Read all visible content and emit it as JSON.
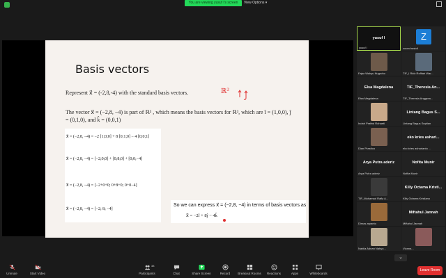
{
  "banner": {
    "viewing": "You are viewing yusuf l's screen",
    "view_options": "View Options ▾"
  },
  "slide": {
    "title": "Basis vectors",
    "represent": "Represent  x⃗ = (-2,8,-4) with the standard basis vectors.",
    "handwriting": "ℝ²",
    "para1": "The vector x⃗ = (−2,8, −4) is part of ℝ³ , which means the basis vectors for ℝ³, which are î = (1,0,0), ĵ = (0,1,0), and k̂ = (0,0,1)",
    "eq1": "x⃗ = (−2,8, −4) = −2 [1;0;0] + 8 [0;1;0] − 4 [0;0;1]",
    "eq2": "x⃗ = (−2,8, −4) = [−2;0;0] + [0;8;0] + [0;0;−4]",
    "eq3": "x⃗ = (−2,8, −4) = [−2+0+0; 0+8+0; 0+0−4]",
    "eq4": "x⃗ = (−2,8, −4) = [−2; 8; −4]",
    "so_text": "So we can express x⃗ = (−2,8, −4) in terms of basis vectors as",
    "so_eq": "x⃗ = −2î + 8ĵ − 4k̂"
  },
  "participants": [
    {
      "name": "yusuf l",
      "sub": "yusuf l"
    },
    {
      "name": "Z",
      "sub": "zoom basic4"
    },
    {
      "name": "",
      "sub": "Fajar Wahyu Nugroho"
    },
    {
      "name": "",
      "sub": "TIF_I Ridz Rofifah War..."
    },
    {
      "name": "Elsa Magdalena",
      "sub": "Elsa Magdalena"
    },
    {
      "name": "TIF_Theresia An...",
      "sub": "TIF_Theresia Anggrea..."
    },
    {
      "name": "",
      "sub": "Indah Pratiwi Rohaeti"
    },
    {
      "name": "Lintang Bagus S...",
      "sub": "Lintang Bagus Septian"
    },
    {
      "name": "",
      "sub": "Dian Prastica"
    },
    {
      "name": "eko kries ashari...",
      "sub": "eko kries asharianto ..."
    },
    {
      "name": "Arya Putra aderiz",
      "sub": "Arya Putra aderiz"
    },
    {
      "name": "Nofita Munir",
      "sub": "Nofita Munir"
    },
    {
      "name": "",
      "sub": "TIF_Muhamad Rafly A..."
    },
    {
      "name": "Killy Octama Kristi...",
      "sub": "Killy Octama Kristiano"
    },
    {
      "name": "",
      "sub": "Dimas aryanto"
    },
    {
      "name": "Miftahul Jannah",
      "sub": "Miftahul Jannah"
    },
    {
      "name": "",
      "sub": "Nabila Adnan Nahyu..."
    },
    {
      "name": "",
      "sub": "Vionna..."
    }
  ],
  "toolbar": {
    "unmute": "Unmute",
    "start_video": "Start Video",
    "participants": "Participants",
    "participants_count": "38",
    "chat": "Chat",
    "share_screen": "Share Screen",
    "record": "Record",
    "breakout": "Breakout Rooms",
    "reactions": "Reactions",
    "apps": "Apps",
    "whiteboards": "Whiteboards",
    "leave": "Leave Room"
  }
}
